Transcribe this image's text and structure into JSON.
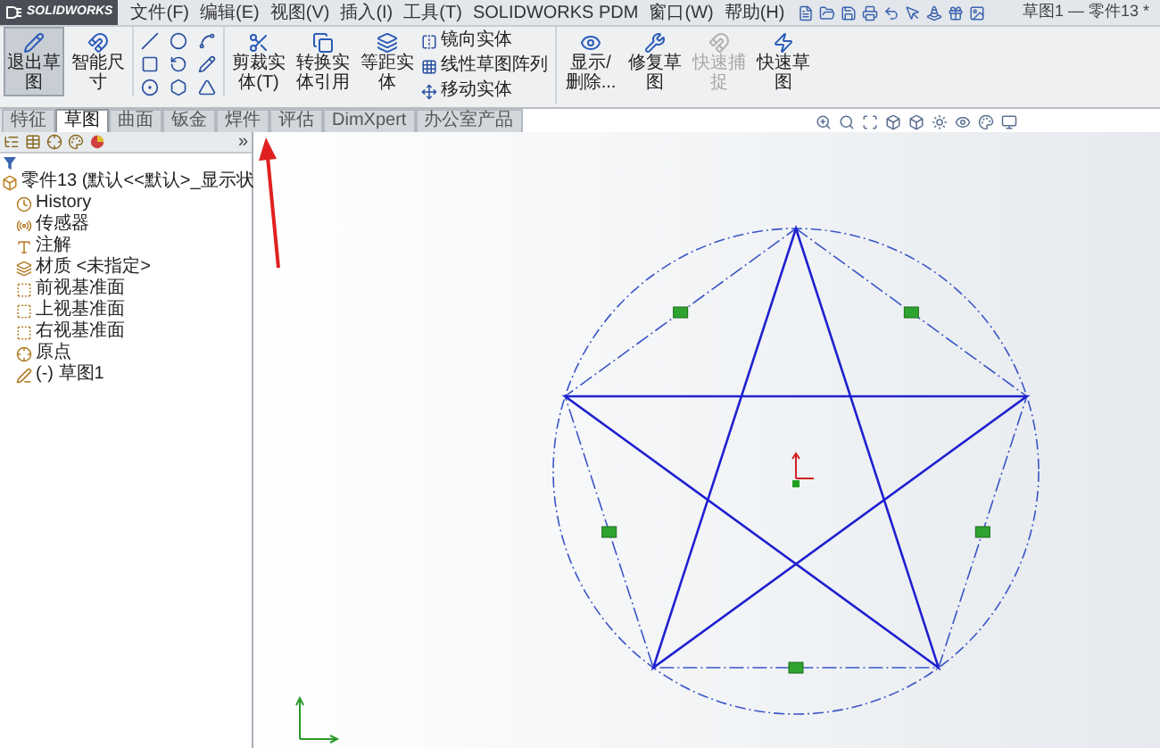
{
  "app": {
    "logo": "SOLIDWORKS",
    "document_title": "草图1 — 零件13 *"
  },
  "menu": [
    "文件(F)",
    "编辑(E)",
    "视图(V)",
    "插入(I)",
    "工具(T)",
    "SOLIDWORKS PDM",
    "窗口(W)",
    "帮助(H)"
  ],
  "ribbon": [
    {
      "kind": "large",
      "label": "退出草图",
      "selected": true,
      "disabled": false
    },
    {
      "kind": "large",
      "label": "智能尺寸",
      "selected": false,
      "disabled": false
    },
    {
      "kind": "tools"
    },
    {
      "kind": "large",
      "label": "剪裁实体(T)",
      "selected": false,
      "disabled": false
    },
    {
      "kind": "large",
      "label": "转换实体引用",
      "selected": false,
      "disabled": false
    },
    {
      "kind": "large",
      "label": "等距实体",
      "selected": false,
      "disabled": false
    },
    {
      "kind": "stack",
      "items": [
        "镜向实体",
        "线性草图阵列",
        "移动实体"
      ]
    },
    {
      "kind": "large",
      "label": "显示/删除...",
      "selected": false,
      "disabled": false
    },
    {
      "kind": "large",
      "label": "修复草图",
      "selected": false,
      "disabled": false
    },
    {
      "kind": "large",
      "label": "快速捕捉",
      "selected": false,
      "disabled": true
    },
    {
      "kind": "large",
      "label": "快速草图",
      "selected": false,
      "disabled": false
    }
  ],
  "tabs": [
    {
      "label": "特征",
      "selected": false
    },
    {
      "label": "草图",
      "selected": true
    },
    {
      "label": "曲面",
      "selected": false
    },
    {
      "label": "钣金",
      "selected": false
    },
    {
      "label": "焊件",
      "selected": false
    },
    {
      "label": "评估",
      "selected": false
    },
    {
      "label": "DimXpert",
      "selected": false
    },
    {
      "label": "办公室产品",
      "selected": false
    }
  ],
  "panel": {
    "expand_glyph": "»"
  },
  "tree": {
    "label": "零件13 (默认<<默认>_显示状",
    "children": [
      {
        "label": "History"
      },
      {
        "label": "传感器"
      },
      {
        "label": "注解"
      },
      {
        "label": "材质 <未指定>"
      },
      {
        "label": "前视基准面"
      },
      {
        "label": "上视基准面"
      },
      {
        "label": "右视基准面"
      },
      {
        "label": "原点"
      },
      {
        "label": "(-) 草图1"
      }
    ]
  }
}
